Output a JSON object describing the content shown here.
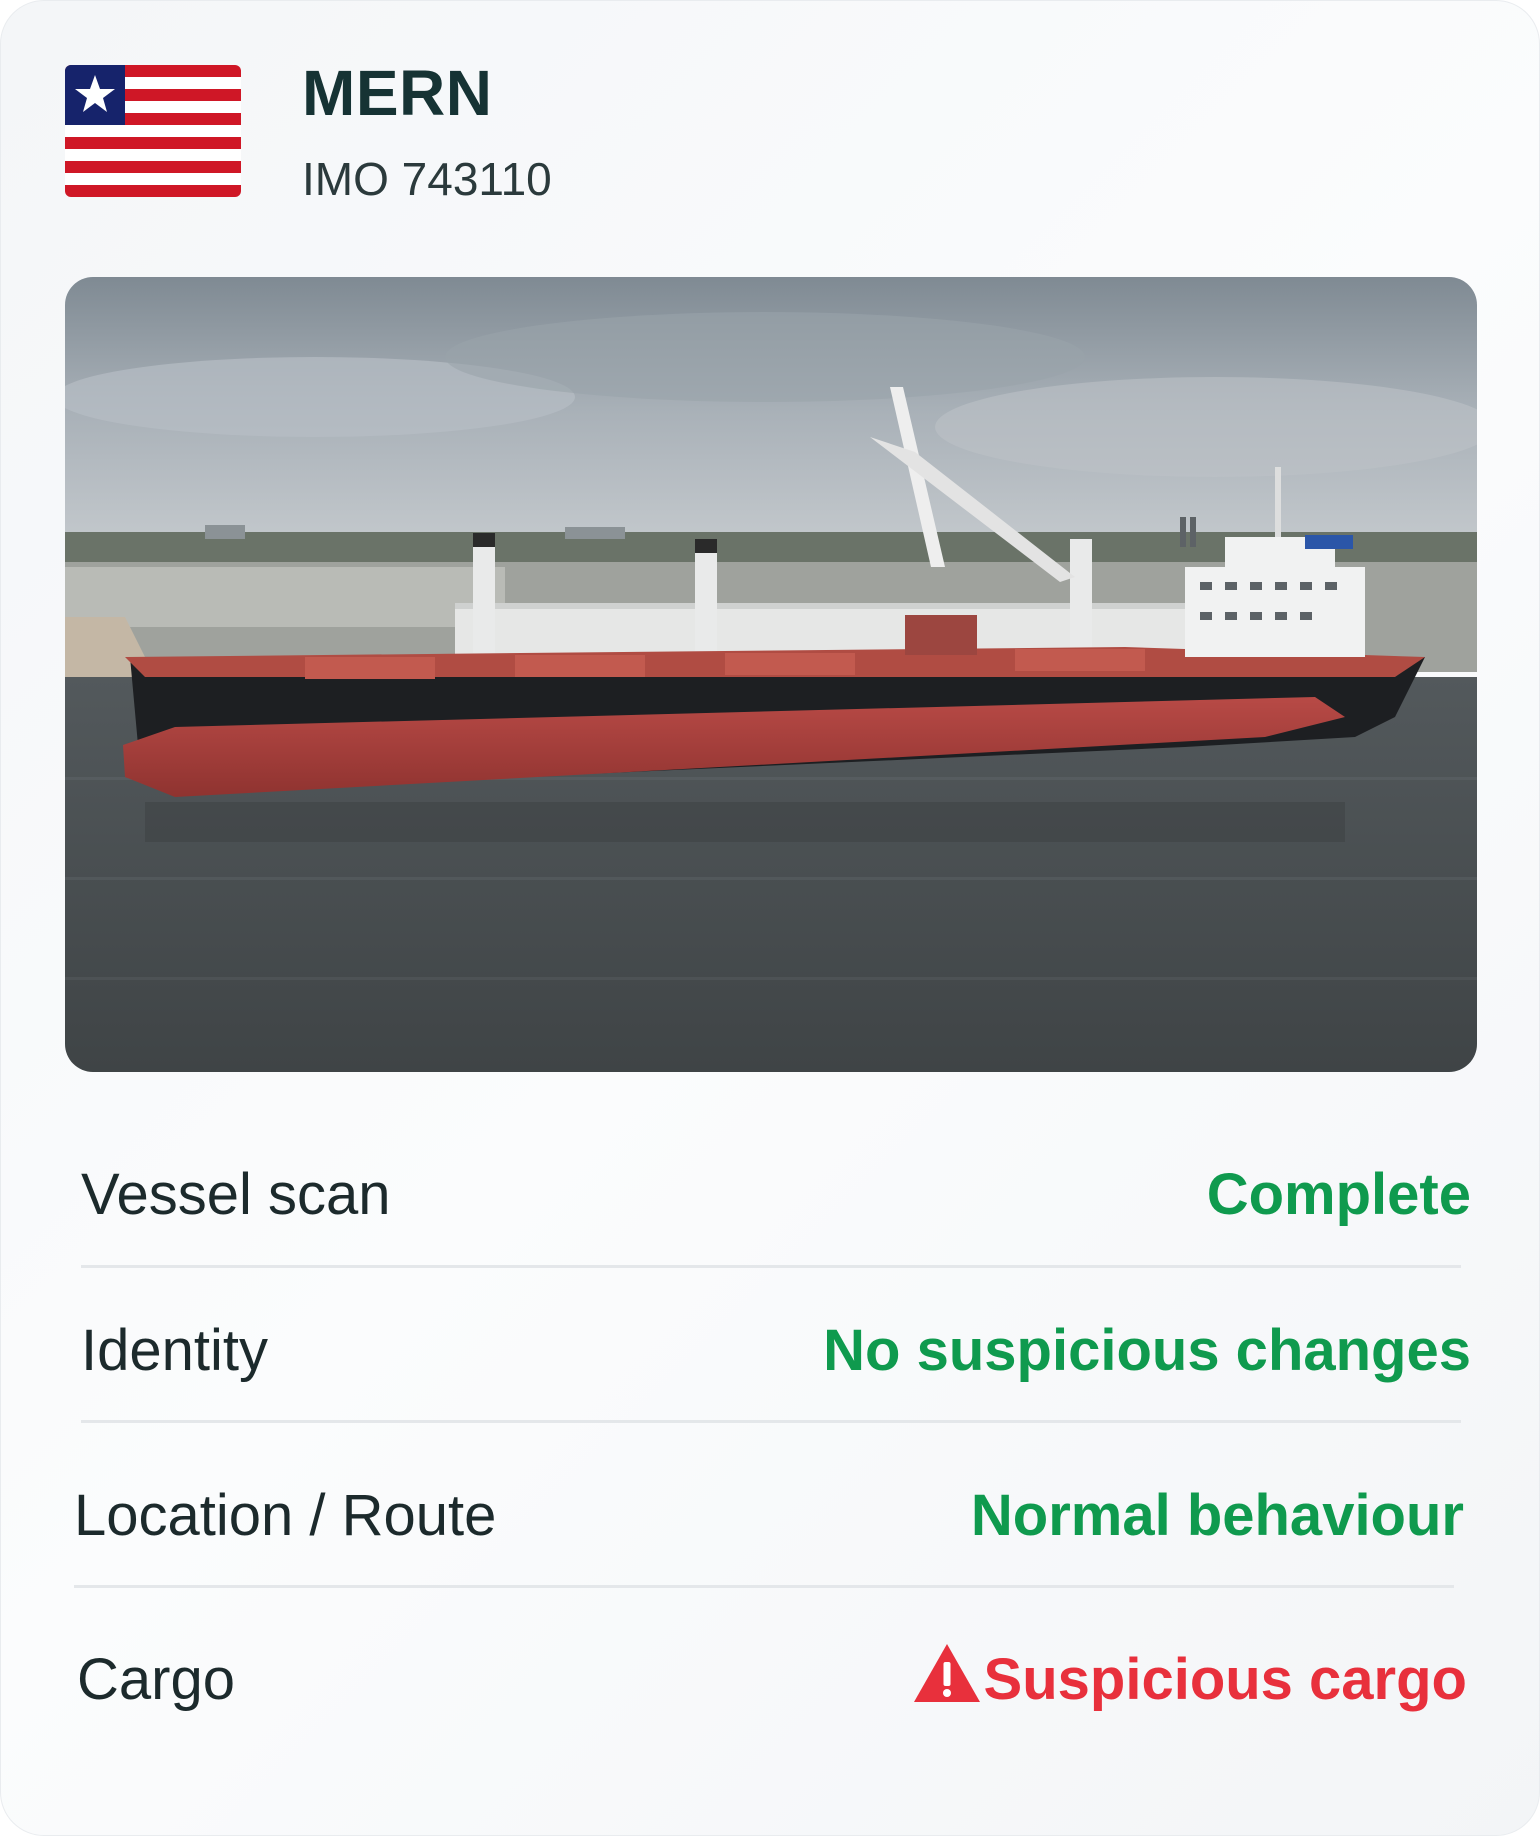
{
  "vessel": {
    "name": "MERN",
    "imo": "IMO 743110",
    "flag_icon": "liberia-flag-icon"
  },
  "photo": {
    "subject": "ship-photo"
  },
  "rows": [
    {
      "label": "Vessel scan",
      "value": "Complete",
      "status": "ok"
    },
    {
      "label": "Identity",
      "value": "No suspicious changes",
      "status": "ok"
    },
    {
      "label": "Location / Route",
      "value": "Normal behaviour",
      "status": "ok"
    },
    {
      "label": "Cargo",
      "value": "Suspicious cargo",
      "status": "alert",
      "icon": "warning-triangle-icon"
    }
  ],
  "colors": {
    "ok": "#0f9a4e",
    "alert": "#e8303c",
    "title": "#163334"
  }
}
